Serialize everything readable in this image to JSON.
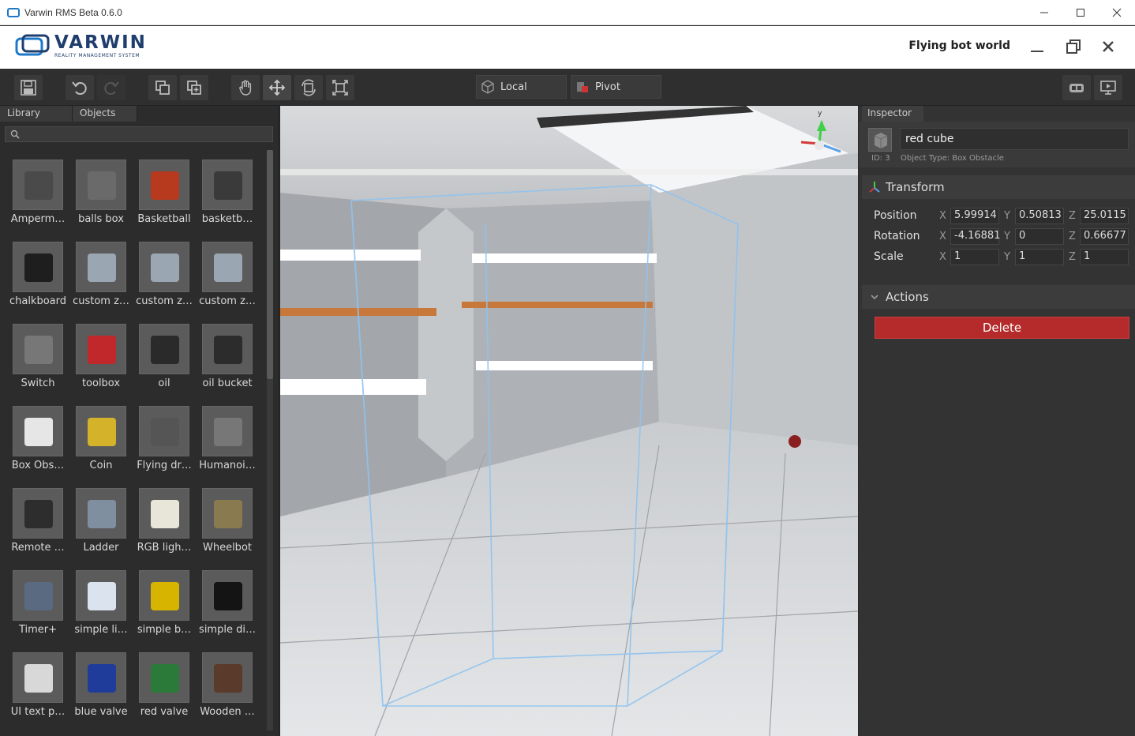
{
  "window": {
    "title": "Varwin RMS Beta 0.6.0"
  },
  "header": {
    "logo_text": "VARWIN",
    "logo_sub": "REALITY MANAGEMENT SYSTEM",
    "world_title": "Flying bot world"
  },
  "toolbar": {
    "coord_space": "Local",
    "pivot": "Pivot"
  },
  "left_panel": {
    "tabs": [
      "Library",
      "Objects"
    ],
    "search_placeholder": "",
    "items": [
      "Amperm…",
      "balls box",
      "Basketball",
      "basketb…",
      "chalkboard",
      "custom z…",
      "custom z…",
      "custom z…",
      "Switch",
      "toolbox",
      "oil",
      "oil bucket",
      "Box Obs…",
      "Coin",
      "Flying dr…",
      "Humanoi…",
      "Remote …",
      "Ladder",
      "RGB ligh…",
      "Wheelbot",
      "Timer+",
      "simple li…",
      "simple b…",
      "simple di…",
      "UI text p…",
      "blue valve",
      "red valve",
      "Wooden …"
    ]
  },
  "inspector": {
    "tab": "Inspector",
    "name": "red cube",
    "id": "ID: 3",
    "type": "Object Type: Box Obstacle",
    "transform_title": "Transform",
    "axes": {
      "x": "X",
      "y": "Y",
      "z": "Z"
    },
    "position": {
      "label": "Position",
      "x": "5.99914",
      "y": "0.50813",
      "z": "25.0115"
    },
    "rotation": {
      "label": "Rotation",
      "x": "-4.16881",
      "y": "0",
      "z": "0.66677"
    },
    "scale": {
      "label": "Scale",
      "x": "1",
      "y": "1",
      "z": "1"
    },
    "actions_title": "Actions",
    "delete_label": "Delete"
  },
  "colors": {
    "accent_blue": "#1e78c8",
    "delete_red": "#b52b2b",
    "gizmo_green": "#3fd04a"
  }
}
